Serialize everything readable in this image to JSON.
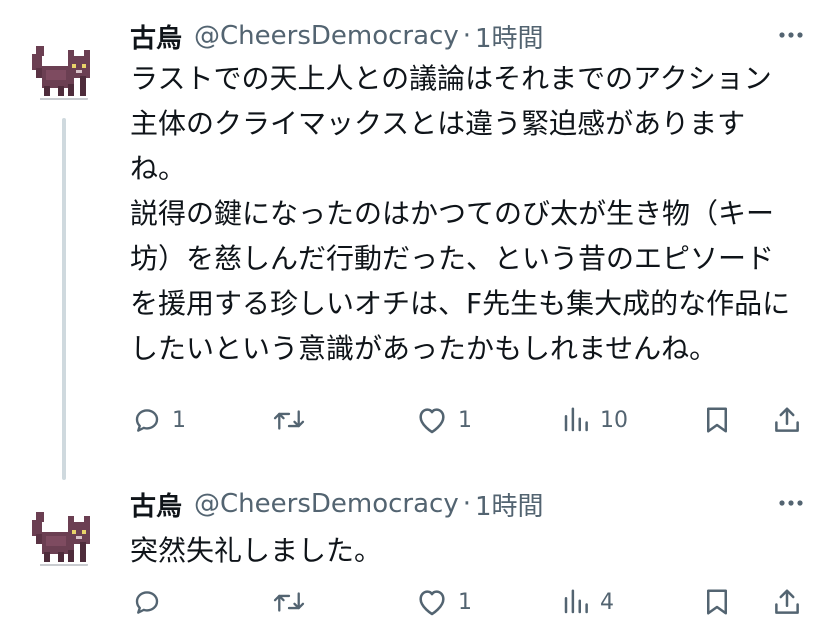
{
  "tweets": [
    {
      "display_name": "古烏",
      "handle": "@CheersDemocracy",
      "separator": "·",
      "time": "1時間",
      "text": "ラストでの天上人との議論はそれまでのアクション主体のクライマックスとは違う緊迫感がありますね。\n説得の鍵になったのはかつてのび太が生き物（キー坊）を慈しんだ行動だった、という昔のエピソードを援用する珍しいオチは、F先生も集大成的な作品にしたいという意識があったかもしれませんね。",
      "reply_count": "1",
      "retweet_count": "",
      "like_count": "1",
      "view_count": "10"
    },
    {
      "display_name": "古烏",
      "handle": "@CheersDemocracy",
      "separator": "·",
      "time": "1時間",
      "text": "突然失礼しました。",
      "reply_count": "",
      "retweet_count": "",
      "like_count": "1",
      "view_count": "4"
    }
  ],
  "icons": {
    "more": "more-dots-icon",
    "reply": "reply-bubble-icon",
    "retweet": "retweet-arrows-icon",
    "like": "heart-icon",
    "views": "bar-chart-icon",
    "bookmark": "bookmark-icon",
    "share": "share-upload-icon",
    "avatar": "pixel-cat-avatar"
  },
  "colors": {
    "text": "#0f1419",
    "secondary": "#536471",
    "thread_line": "#cfd9de",
    "avatar_cat": "#6b3f52"
  }
}
